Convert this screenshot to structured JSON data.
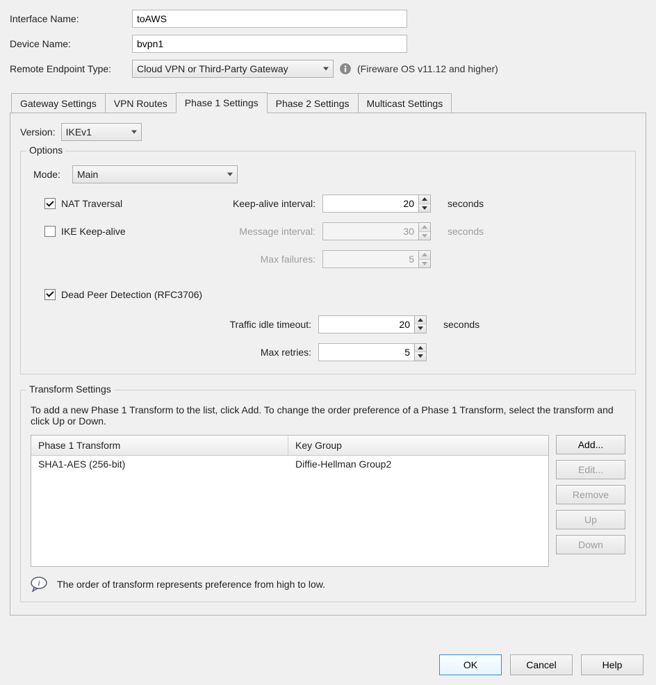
{
  "header": {
    "interface_label": "Interface Name:",
    "interface_value": "toAWS",
    "device_label": "Device Name:",
    "device_value": "bvpn1",
    "endpoint_label": "Remote Endpoint Type:",
    "endpoint_value": "Cloud VPN or Third-Party Gateway",
    "endpoint_hint": "(Fireware OS v11.12 and higher)"
  },
  "tabs": [
    {
      "label": "Gateway Settings"
    },
    {
      "label": "VPN Routes"
    },
    {
      "label": "Phase 1 Settings"
    },
    {
      "label": "Phase 2 Settings"
    },
    {
      "label": "Multicast Settings"
    }
  ],
  "phase1": {
    "version_label": "Version:",
    "version_value": "IKEv1",
    "options_legend": "Options",
    "mode_label": "Mode:",
    "mode_value": "Main",
    "nat_label": "NAT Traversal",
    "keepalive_interval_label": "Keep-alive interval:",
    "keepalive_interval_value": "20",
    "seconds": "seconds",
    "ike_label": "IKE Keep-alive",
    "message_interval_label": "Message interval:",
    "message_interval_value": "30",
    "max_failures_label": "Max failures:",
    "max_failures_value": "5",
    "dpd_label": "Dead Peer Detection (RFC3706)",
    "traffic_idle_label": "Traffic idle timeout:",
    "traffic_idle_value": "20",
    "max_retries_label": "Max retries:",
    "max_retries_value": "5"
  },
  "transform": {
    "legend": "Transform Settings",
    "help_text": "To add a new Phase 1 Transform to the list, click Add. To change the order preference of a Phase 1 Transform, select the transform and click Up or Down.",
    "col1": "Phase 1 Transform",
    "col2": "Key Group",
    "rows": [
      {
        "c1": "SHA1-AES (256-bit)",
        "c2": "Diffie-Hellman Group2"
      }
    ],
    "add": "Add...",
    "edit": "Edit...",
    "remove": "Remove",
    "up": "Up",
    "down": "Down",
    "order_hint": "The order of transform represents preference from high to low."
  },
  "footer": {
    "ok": "OK",
    "cancel": "Cancel",
    "help": "Help"
  }
}
